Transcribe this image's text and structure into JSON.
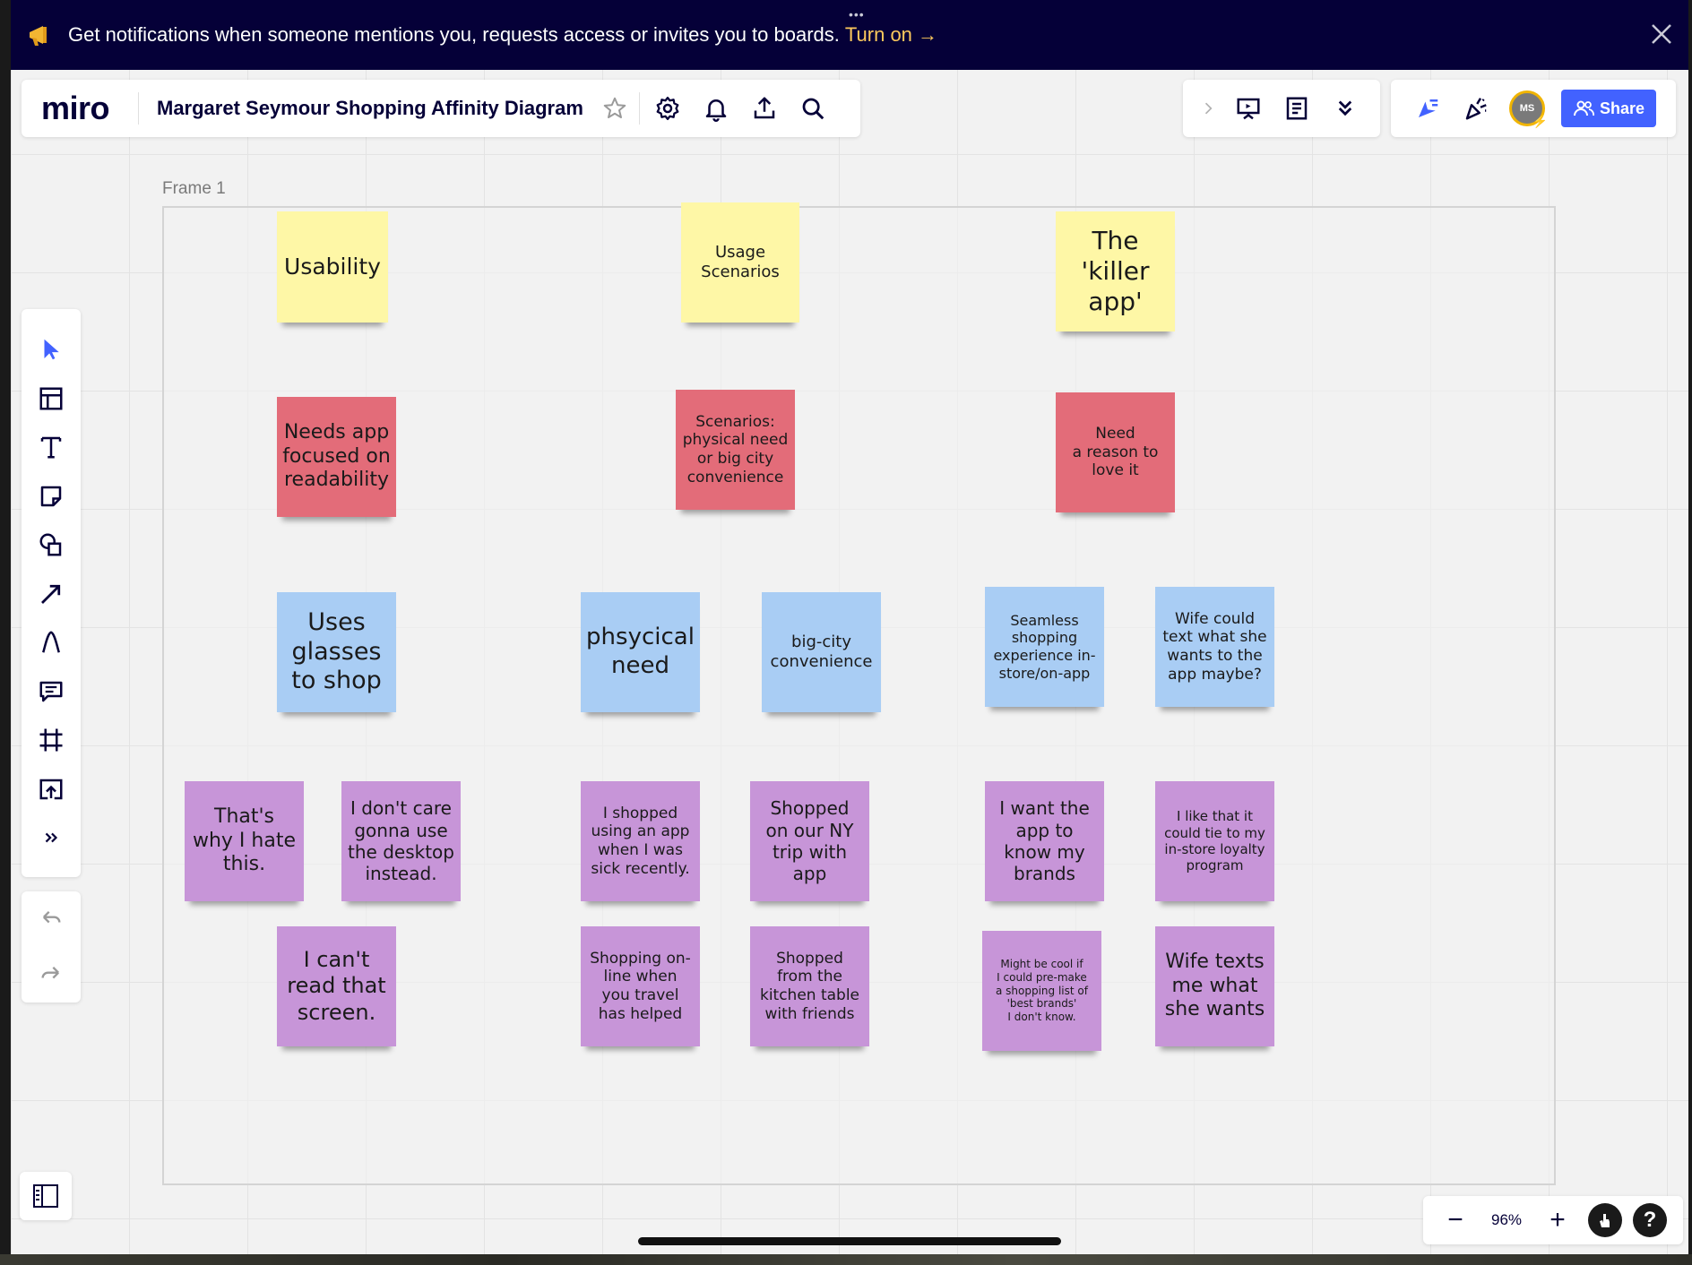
{
  "banner": {
    "text": "Get notifications when someone mentions you, requests access or invites you to boards.",
    "action": "Turn on →",
    "dots": "•••"
  },
  "toolbar": {
    "logo": "miro",
    "board_title": "Margaret Seymour Shopping Affinity Diagram",
    "icons": [
      "star-icon",
      "gear-icon",
      "bell-icon",
      "upload-icon",
      "search-icon"
    ]
  },
  "toolbar_mid": {
    "icons": [
      "chevron-right-icon",
      "presentation-icon",
      "notes-icon",
      "double-chevron-down-icon"
    ]
  },
  "toolbar_right": {
    "avatar_initials": "MS",
    "share_label": "Share"
  },
  "frame": {
    "label": "Frame 1"
  },
  "stickies": [
    {
      "text": "Usability",
      "color": "yellow"
    },
    {
      "text": "Usage\nScenarios",
      "color": "yellow"
    },
    {
      "text": "The\n'killer\napp'",
      "color": "yellow"
    },
    {
      "text": "Needs app\nfocused on\nreadability",
      "color": "red"
    },
    {
      "text": "Scenarios:\nphysical need\nor big city\nconvenience",
      "color": "red"
    },
    {
      "text": "Need\na reason to\nlove it",
      "color": "red"
    },
    {
      "text": "Uses\nglasses\nto shop",
      "color": "blue"
    },
    {
      "text": "phsycical\nneed",
      "color": "blue"
    },
    {
      "text": "big-city\nconvenience",
      "color": "blue"
    },
    {
      "text": "Seamless\nshopping\nexperience in-\nstore/on-app",
      "color": "blue"
    },
    {
      "text": "Wife could\ntext what she\nwants to the\napp maybe?",
      "color": "blue"
    },
    {
      "text": "That's\nwhy I hate\nthis.",
      "color": "purple"
    },
    {
      "text": "I don't care\ngonna use\nthe desktop\ninstead.",
      "color": "purple"
    },
    {
      "text": "I shopped\nusing an app\nwhen I was\nsick recently.",
      "color": "purple"
    },
    {
      "text": "Shopped\non our NY\ntrip with\napp",
      "color": "purple"
    },
    {
      "text": "I want the\napp to\nknow my\nbrands",
      "color": "purple"
    },
    {
      "text": "I like that it\ncould tie to my\nin-store loyalty\nprogram",
      "color": "purple"
    },
    {
      "text": "I can't\nread that\nscreen.",
      "color": "purple"
    },
    {
      "text": "Shopping on-\nline when\nyou travel\nhas helped",
      "color": "purple"
    },
    {
      "text": "Shopped\nfrom the\nkitchen table\nwith friends",
      "color": "purple"
    },
    {
      "text": "Might be cool if\nI could pre-make\na shopping list of\n'best brands'\nI don't know.",
      "color": "purple"
    },
    {
      "text": "Wife texts\nme what\nshe wants",
      "color": "purple"
    }
  ],
  "zoom": {
    "value": "96%",
    "minus": "−",
    "plus": "+",
    "help": "?"
  },
  "colors": {
    "banner_bg": "#050038",
    "accent": "#4262ff",
    "turn_on": "#fdc95d",
    "yellow": "#fef7a6",
    "red": "#e36c79",
    "blue": "#a9cdf4",
    "purple": "#c795d8"
  }
}
